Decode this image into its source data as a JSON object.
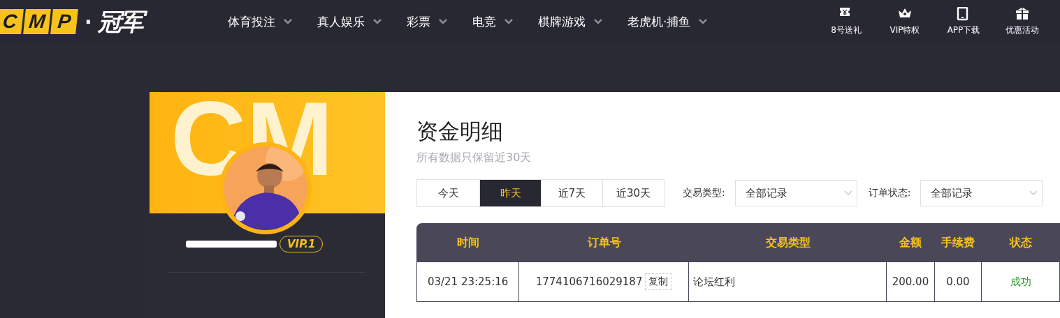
{
  "logo": {
    "letters": [
      "C",
      "M",
      "P"
    ],
    "dot": "·",
    "name": "冠军"
  },
  "nav": [
    {
      "label": "体育投注"
    },
    {
      "label": "真人娱乐"
    },
    {
      "label": "彩票"
    },
    {
      "label": "电竞"
    },
    {
      "label": "棋牌游戏"
    },
    {
      "label": "老虎机·捕鱼"
    }
  ],
  "quick_links": [
    {
      "kind": "ticket",
      "label": "8号送礼"
    },
    {
      "kind": "crown",
      "label": "VIP特权"
    },
    {
      "kind": "tablet",
      "label": "APP下载"
    },
    {
      "kind": "gift",
      "label": "优惠活动"
    }
  ],
  "profile": {
    "banner_text": "CM",
    "vip": "VIP.1"
  },
  "page": {
    "title": "资金明细",
    "subtitle": "所有数据只保留近30天"
  },
  "date_tabs": [
    {
      "label": "今天",
      "selected": false
    },
    {
      "label": "昨天",
      "selected": true
    },
    {
      "label": "近7天",
      "selected": false
    },
    {
      "label": "近30天",
      "selected": false
    }
  ],
  "filters": [
    {
      "label": "交易类型:",
      "value": "全部记录"
    },
    {
      "label": "订单状态:",
      "value": "全部记录"
    }
  ],
  "table": {
    "columns": [
      "时间",
      "订单号",
      "交易类型",
      "金额",
      "手续费",
      "状态"
    ],
    "rows": [
      {
        "time": "03/21 23:25:16",
        "order": "1774106716029187",
        "copy": "复制",
        "type": "论坛红利",
        "amount": "200.00",
        "fee": "0.00",
        "status": "成功",
        "color": "#2a9d2a"
      }
    ]
  }
}
